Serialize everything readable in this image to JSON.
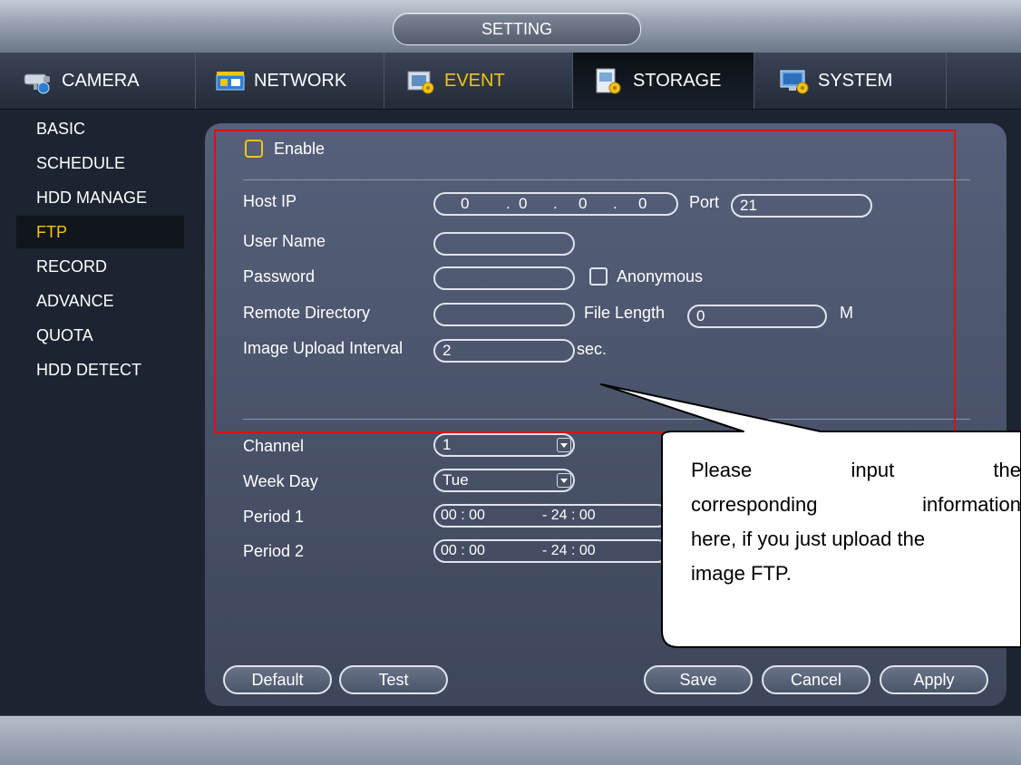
{
  "header": {
    "title": "SETTING"
  },
  "tabs": [
    {
      "label": "CAMERA",
      "icon": "camera-icon"
    },
    {
      "label": "NETWORK",
      "icon": "network-icon"
    },
    {
      "label": "EVENT",
      "icon": "event-icon"
    },
    {
      "label": "STORAGE",
      "icon": "storage-icon"
    },
    {
      "label": "SYSTEM",
      "icon": "system-icon"
    }
  ],
  "sidebar": {
    "items": [
      {
        "label": "BASIC"
      },
      {
        "label": "SCHEDULE"
      },
      {
        "label": "HDD MANAGE"
      },
      {
        "label": "FTP"
      },
      {
        "label": "RECORD"
      },
      {
        "label": "ADVANCE"
      },
      {
        "label": "QUOTA"
      },
      {
        "label": "HDD DETECT"
      }
    ],
    "active": "FTP"
  },
  "form": {
    "enable_label": "Enable",
    "enable_checked": false,
    "host_ip_label": "Host IP",
    "host_ip": {
      "o1": "0",
      "o2": "0",
      "o3": "0",
      "o4": "0",
      "dot": "."
    },
    "port_label": "Port",
    "port_value": "21",
    "user_name_label": "User Name",
    "user_name_value": "",
    "password_label": "Password",
    "password_value": "",
    "anonymous_label": "Anonymous",
    "anonymous_checked": false,
    "remote_dir_label": "Remote Directory",
    "remote_dir_value": "",
    "file_length_label": "File Length",
    "file_length_value": "0",
    "file_length_unit": "M",
    "image_interval_label": "Image Upload Interval",
    "image_interval_value": "2",
    "image_interval_unit": "sec.",
    "channel_label": "Channel",
    "channel_value": "1",
    "weekday_label": "Week Day",
    "weekday_value": "Tue",
    "period1_label": "Period 1",
    "period1_start": "00 : 00",
    "period1_end": "- 24 : 00",
    "period2_label": "Period 2",
    "period2_start": "00 : 00",
    "period2_end": "- 24 : 00"
  },
  "buttons": {
    "default": "Default",
    "test": "Test",
    "save": "Save",
    "cancel": "Cancel",
    "apply": "Apply"
  },
  "callout": {
    "line1_words": [
      "Please",
      "input",
      "the"
    ],
    "line2_words": [
      "corresponding",
      "information"
    ],
    "line3": "here, if you just upload the",
    "line4": "image FTP."
  },
  "colors": {
    "accent_yellow": "#f3c312",
    "highlight_red": "#e01010",
    "panel": "#4a546a",
    "background": "#1c2431"
  }
}
